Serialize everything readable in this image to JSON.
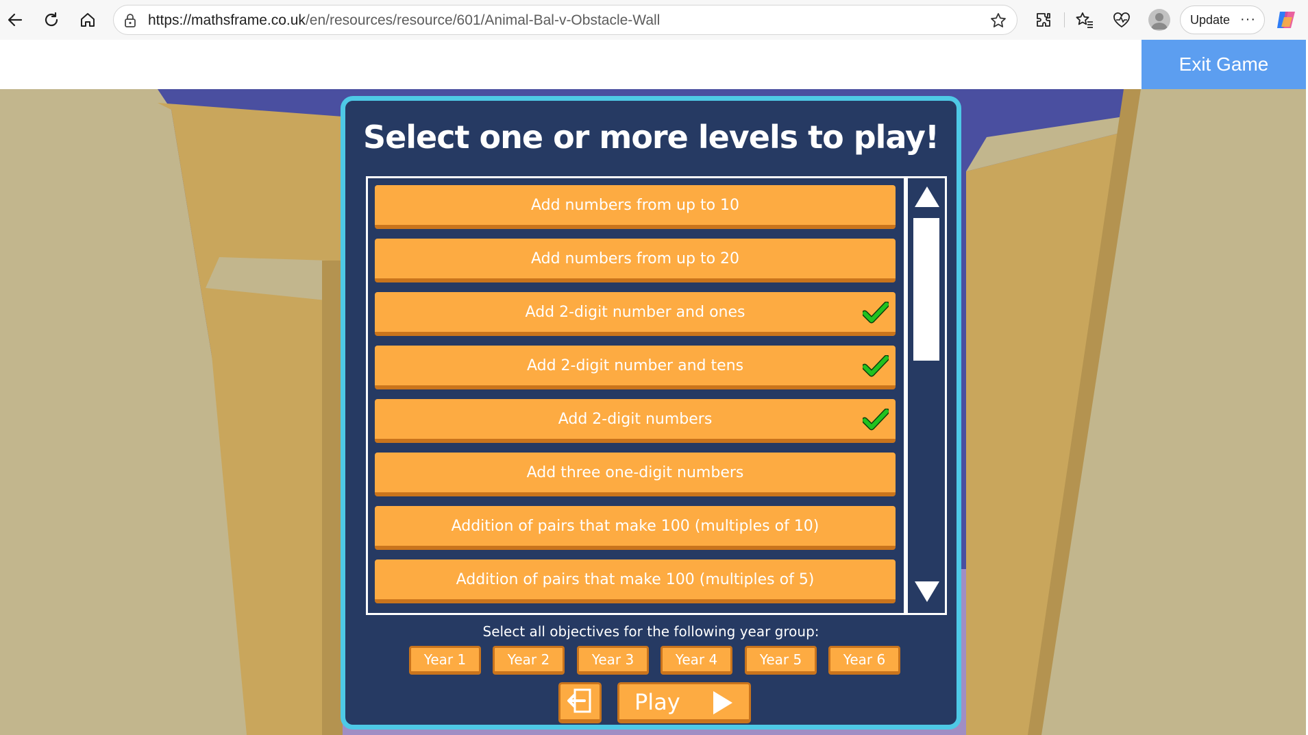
{
  "browser": {
    "url_host": "https://mathsframe.co.uk",
    "url_path": "/en/resources/resource/601/Animal-Bal-v-Obstacle-Wall",
    "update_label": "Update",
    "more_label": "···"
  },
  "site": {
    "exit_label": "Exit Game"
  },
  "game": {
    "title": "Select one or more levels to play!",
    "levels": [
      {
        "label": "Add numbers from up to 10",
        "selected": false
      },
      {
        "label": "Add numbers from up to 20",
        "selected": false
      },
      {
        "label": "Add 2-digit number and ones",
        "selected": true
      },
      {
        "label": "Add 2-digit number and tens",
        "selected": true
      },
      {
        "label": "Add 2-digit numbers",
        "selected": true
      },
      {
        "label": "Add three one-digit numbers",
        "selected": false
      },
      {
        "label": "Addition of pairs that make 100 (multiples of 10)",
        "selected": false
      },
      {
        "label": "Addition of pairs that make 100 (multiples of 5)",
        "selected": false
      }
    ],
    "year_caption": "Select all objectives for the following year group:",
    "years": [
      "Year 1",
      "Year 2",
      "Year 3",
      "Year 4",
      "Year 5",
      "Year 6"
    ],
    "play_label": "Play",
    "colors": {
      "panel": "#263a63",
      "panel_border": "#4ec9e6",
      "button": "#fdab42",
      "check": "#21c21f",
      "sky": "#4a4fa0"
    }
  }
}
